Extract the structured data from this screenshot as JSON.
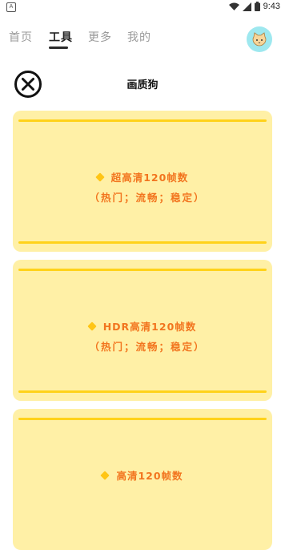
{
  "status_bar": {
    "left_icon_label": "A",
    "time": "9:43"
  },
  "nav": {
    "tabs": [
      {
        "label": "首页"
      },
      {
        "label": "工具"
      },
      {
        "label": "更多"
      },
      {
        "label": "我的"
      }
    ],
    "active_tab": "工具"
  },
  "header": {
    "title": "画质狗"
  },
  "cards": [
    {
      "title": "超高清120帧数",
      "subtitle": "（热门；流畅；稳定）"
    },
    {
      "title": "HDR高清120帧数",
      "subtitle": "（热门；流畅；稳定）"
    },
    {
      "title": "高清120帧数",
      "subtitle": ""
    }
  ],
  "colors": {
    "card_bg": "#fff0a6",
    "card_line": "#ffd21a",
    "card_text": "#f2751f",
    "avatar_bg": "#9ee8ef"
  }
}
